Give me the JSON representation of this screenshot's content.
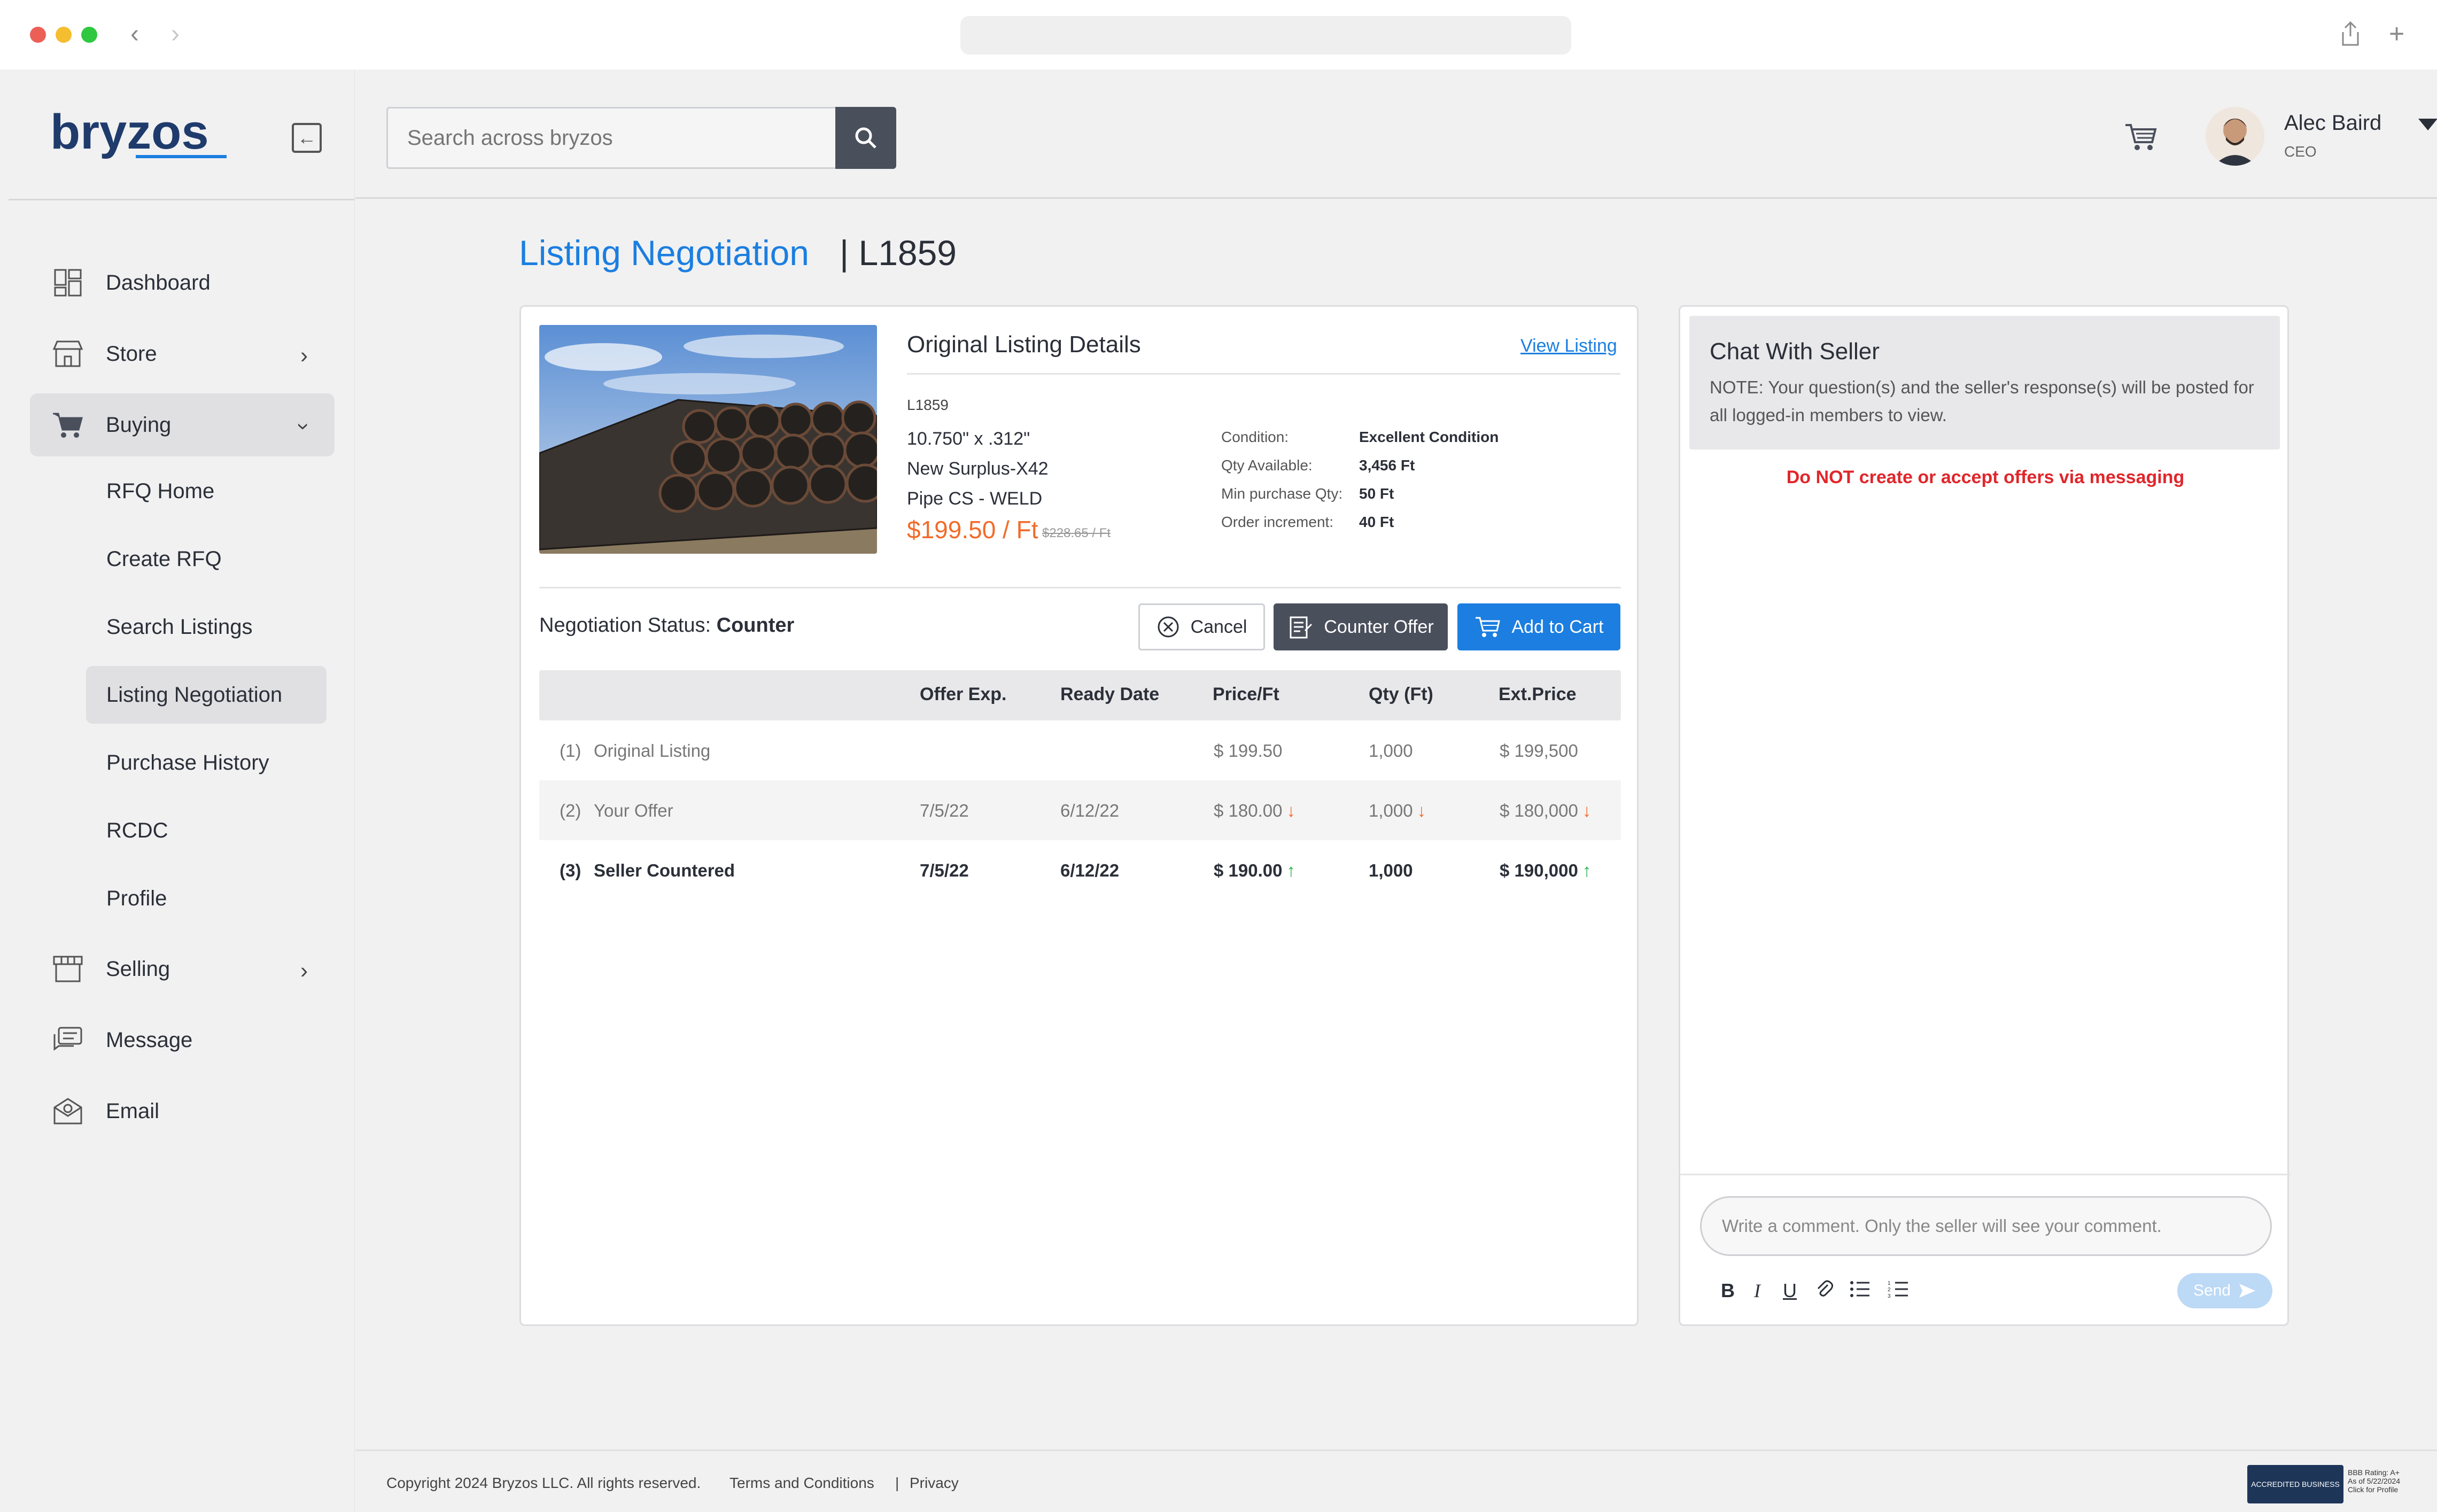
{
  "sidebar": {
    "logo_text": "bryzos",
    "items": [
      {
        "label": "Dashboard"
      },
      {
        "label": "Store"
      },
      {
        "label": "Buying"
      },
      {
        "label": "Selling"
      },
      {
        "label": "Message"
      },
      {
        "label": "Email"
      }
    ],
    "buying_sub": [
      {
        "label": "RFQ Home"
      },
      {
        "label": "Create RFQ"
      },
      {
        "label": "Search Listings"
      },
      {
        "label": "Listing Negotiation"
      },
      {
        "label": "Purchase History"
      },
      {
        "label": "RCDC"
      },
      {
        "label": "Profile"
      }
    ]
  },
  "header": {
    "search_placeholder": "Search across bryzos",
    "user_name": "Alec Baird",
    "user_role": "CEO"
  },
  "page": {
    "title": "Listing Negotiation",
    "id": "| L1859"
  },
  "listing": {
    "section_title": "Original Listing Details",
    "view_link": "View Listing",
    "id": "L1859",
    "spec1": "10.750\" x .312\"",
    "spec2": "New Surplus-X42",
    "spec3": "Pipe CS - WELD",
    "price": "$199.50 / Ft",
    "old_price": "$228.65 / Ft",
    "details": [
      {
        "label": "Condition:",
        "value": "Excellent Condition"
      },
      {
        "label": "Qty Available:",
        "value": "3,456 Ft"
      },
      {
        "label": "Min purchase Qty:",
        "value": "50 Ft"
      },
      {
        "label": "Order increment:",
        "value": "40 Ft"
      }
    ]
  },
  "negotiation": {
    "status_label": "Negotiation Status:",
    "status_value": "Counter",
    "cancel": "Cancel",
    "counter": "Counter Offer",
    "add_cart": "Add to Cart",
    "columns": [
      "Offer Exp.",
      "Ready Date",
      "Price/Ft",
      "Qty (Ft)",
      "Ext.Price"
    ],
    "rows": [
      {
        "num": "(1)",
        "name": "Original Listing",
        "exp": "",
        "ready": "",
        "price": "$ 199.50",
        "qty": "1,000",
        "ext": "$ 199,500"
      },
      {
        "num": "(2)",
        "name": "Your Offer",
        "exp": "7/5/22",
        "ready": "6/12/22",
        "price": "$ 180.00",
        "qty": "1,000",
        "ext": "$ 180,000"
      },
      {
        "num": "(3)",
        "name": "Seller Countered",
        "exp": "7/5/22",
        "ready": "6/12/22",
        "price": "$ 190.00",
        "qty": "1,000",
        "ext": "$ 190,000"
      }
    ]
  },
  "chat": {
    "title": "Chat With Seller",
    "note": "NOTE: Your question(s) and the seller's response(s) will be posted for all logged-in members to view.",
    "warning": "Do NOT create or accept offers via messaging",
    "placeholder": "Write a comment. Only the seller will see your comment.",
    "send": "Send"
  },
  "footer": {
    "copyright": "Copyright 2024 Bryzos  LLC. All rights reserved.",
    "terms": "Terms and Conditions",
    "sep": "|",
    "privacy": "Privacy",
    "bbb_badge": "ACCREDITED BUSINESS",
    "bbb_rating": "BBB Rating: A+",
    "bbb_date": "As of 5/22/2024",
    "bbb_click": "Click for Profile"
  },
  "colors": {
    "accent": "#1b7ee0",
    "price_orange": "#f26b2a",
    "warn_red": "#e0262b",
    "up_green": "#2bb24c"
  }
}
